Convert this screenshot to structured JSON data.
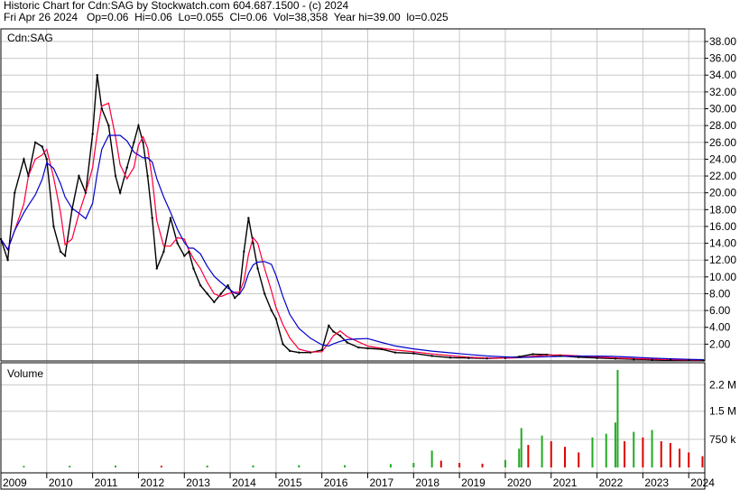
{
  "header": {
    "line1": "Historic Chart for Cdn:SAG by Stockwatch.com 604.687.1500 - (c) 2024",
    "line2": "Fri Apr 26 2024   Op=0.06  Hi=0.06  Lo=0.055  Cl=0.06  Vol=38,358  Year hi=39.00  lo=0.025"
  },
  "colors": {
    "price_bar": "#000000",
    "ma_short": "#ff0000",
    "ma_dot": "#ff00ff",
    "ma_long": "#0000cc",
    "volume_up": "#22aa22",
    "volume_down": "#dd0000",
    "volume_flat": "#888888",
    "grid": "#c8c8c8"
  },
  "chart_data": [
    {
      "type": "line",
      "title": "Cdn:SAG",
      "xlabel": "",
      "ylabel": "",
      "x_ticks": [
        "2009",
        "2010",
        "2011",
        "2012",
        "2013",
        "2014",
        "2015",
        "2016",
        "2017",
        "2018",
        "2019",
        "2020",
        "2021",
        "2022",
        "2023",
        "2024"
      ],
      "y_ticks": [
        "2.00",
        "4.00",
        "6.00",
        "8.00",
        "10.00",
        "12.00",
        "14.00",
        "16.00",
        "18.00",
        "20.00",
        "22.00",
        "24.00",
        "26.00",
        "28.00",
        "30.00",
        "32.00",
        "34.00",
        "36.00",
        "38.00"
      ],
      "ylim": [
        0,
        39.5
      ],
      "grid": true,
      "series": [
        {
          "values": [
            [
              2009.0,
              14.5
            ],
            [
              2009.15,
              12
            ],
            [
              2009.3,
              20
            ],
            [
              2009.5,
              24
            ],
            [
              2009.6,
              22
            ],
            [
              2009.75,
              26
            ],
            [
              2009.9,
              25.5
            ],
            [
              2010.0,
              24
            ],
            [
              2010.15,
              16
            ],
            [
              2010.3,
              13
            ],
            [
              2010.4,
              12.5
            ],
            [
              2010.55,
              18
            ],
            [
              2010.7,
              22
            ],
            [
              2010.85,
              20
            ],
            [
              2011.0,
              27
            ],
            [
              2011.1,
              34
            ],
            [
              2011.2,
              30
            ],
            [
              2011.35,
              28
            ],
            [
              2011.5,
              22
            ],
            [
              2011.6,
              20
            ],
            [
              2011.75,
              23
            ],
            [
              2011.9,
              26
            ],
            [
              2012.0,
              28
            ],
            [
              2012.1,
              26
            ],
            [
              2012.2,
              22
            ],
            [
              2012.3,
              17
            ],
            [
              2012.4,
              11
            ],
            [
              2012.55,
              13
            ],
            [
              2012.7,
              17
            ],
            [
              2012.85,
              14
            ],
            [
              2013.0,
              12.5
            ],
            [
              2013.1,
              13
            ],
            [
              2013.2,
              11
            ],
            [
              2013.35,
              9
            ],
            [
              2013.5,
              8
            ],
            [
              2013.65,
              7
            ],
            [
              2013.8,
              8
            ],
            [
              2013.95,
              9
            ],
            [
              2014.1,
              7.5
            ],
            [
              2014.2,
              8
            ],
            [
              2014.3,
              13
            ],
            [
              2014.4,
              17
            ],
            [
              2014.5,
              14
            ],
            [
              2014.6,
              11
            ],
            [
              2014.75,
              8
            ],
            [
              2014.9,
              6
            ],
            [
              2015.0,
              5
            ],
            [
              2015.15,
              2
            ],
            [
              2015.3,
              1.2
            ],
            [
              2015.5,
              1.0
            ],
            [
              2015.75,
              1.0
            ],
            [
              2016.0,
              1.3
            ],
            [
              2016.15,
              4.2
            ],
            [
              2016.25,
              3.5
            ],
            [
              2016.4,
              3.0
            ],
            [
              2016.55,
              2.2
            ],
            [
              2016.8,
              1.6
            ],
            [
              2017.0,
              1.5
            ],
            [
              2017.3,
              1.4
            ],
            [
              2017.6,
              1.0
            ],
            [
              2018.0,
              0.9
            ],
            [
              2018.4,
              0.6
            ],
            [
              2018.8,
              0.4
            ],
            [
              2019.2,
              0.35
            ],
            [
              2019.6,
              0.3
            ],
            [
              2020.0,
              0.35
            ],
            [
              2020.3,
              0.5
            ],
            [
              2020.6,
              0.8
            ],
            [
              2020.9,
              0.75
            ],
            [
              2021.2,
              0.6
            ],
            [
              2021.6,
              0.45
            ],
            [
              2022.0,
              0.35
            ],
            [
              2022.4,
              0.28
            ],
            [
              2022.8,
              0.2
            ],
            [
              2023.2,
              0.15
            ],
            [
              2023.6,
              0.12
            ],
            [
              2024.0,
              0.08
            ],
            [
              2024.32,
              0.06
            ]
          ]
        }
      ]
    },
    {
      "type": "bar",
      "title": "Volume",
      "xlabel": "",
      "ylabel": "",
      "y_ticks": [
        "750 k",
        "1.5 M",
        "2.2 M"
      ],
      "ylim": [
        0,
        2600000
      ],
      "grid": true,
      "series": [
        {
          "values": [
            [
              2009.5,
              40000
            ],
            [
              2010.5,
              45000
            ],
            [
              2011.5,
              50000
            ],
            [
              2012.5,
              45000
            ],
            [
              2013.5,
              50000
            ],
            [
              2014.5,
              55000
            ],
            [
              2015.5,
              60000
            ],
            [
              2016.5,
              60000
            ],
            [
              2017.5,
              90000
            ],
            [
              2018.0,
              120000
            ],
            [
              2018.4,
              450000
            ],
            [
              2018.6,
              180000
            ],
            [
              2019.0,
              120000
            ],
            [
              2019.5,
              100000
            ],
            [
              2020.0,
              200000
            ],
            [
              2020.3,
              500000
            ],
            [
              2020.35,
              1050000
            ],
            [
              2020.5,
              600000
            ],
            [
              2020.8,
              850000
            ],
            [
              2021.0,
              700000
            ],
            [
              2021.3,
              550000
            ],
            [
              2021.6,
              400000
            ],
            [
              2021.9,
              800000
            ],
            [
              2022.2,
              900000
            ],
            [
              2022.4,
              1200000
            ],
            [
              2022.45,
              2600000
            ],
            [
              2022.6,
              700000
            ],
            [
              2022.8,
              950000
            ],
            [
              2023.0,
              800000
            ],
            [
              2023.2,
              1000000
            ],
            [
              2023.4,
              700000
            ],
            [
              2023.6,
              650000
            ],
            [
              2023.8,
              500000
            ],
            [
              2024.0,
              400000
            ],
            [
              2024.3,
              300000
            ]
          ]
        }
      ]
    }
  ]
}
